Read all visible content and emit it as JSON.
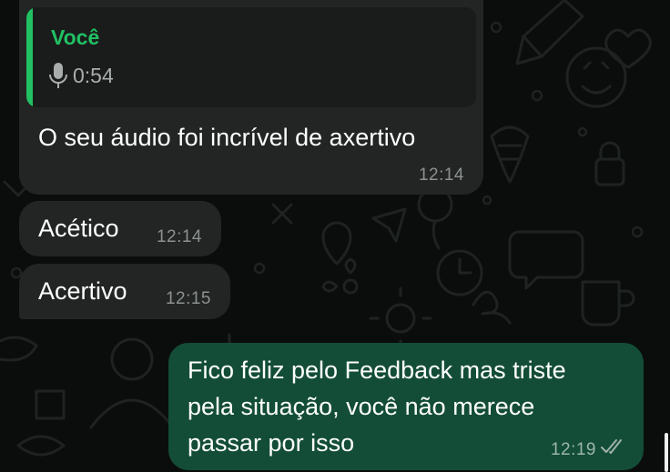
{
  "messages": [
    {
      "direction": "incoming",
      "quote": {
        "author": "Você",
        "icon": "mic-icon",
        "duration": "0:54"
      },
      "text": "O seu áudio foi incrível de axertivo",
      "time": "12:14"
    },
    {
      "direction": "incoming",
      "text": "Acético",
      "time": "12:14"
    },
    {
      "direction": "incoming",
      "text": "Acertivo",
      "time": "12:15"
    },
    {
      "direction": "outgoing",
      "lines": [
        "Fico feliz pelo Feedback mas triste",
        "pela situação, você não merece",
        "passar por isso"
      ],
      "time": "12:19",
      "status_icon": "double-check-icon"
    }
  ],
  "colors": {
    "background": "#0b0d0c",
    "incoming_bubble": "#222524",
    "outgoing_bubble": "#134d37",
    "quote_accent": "#21c063",
    "read_receipt": "#a0b3a9"
  }
}
